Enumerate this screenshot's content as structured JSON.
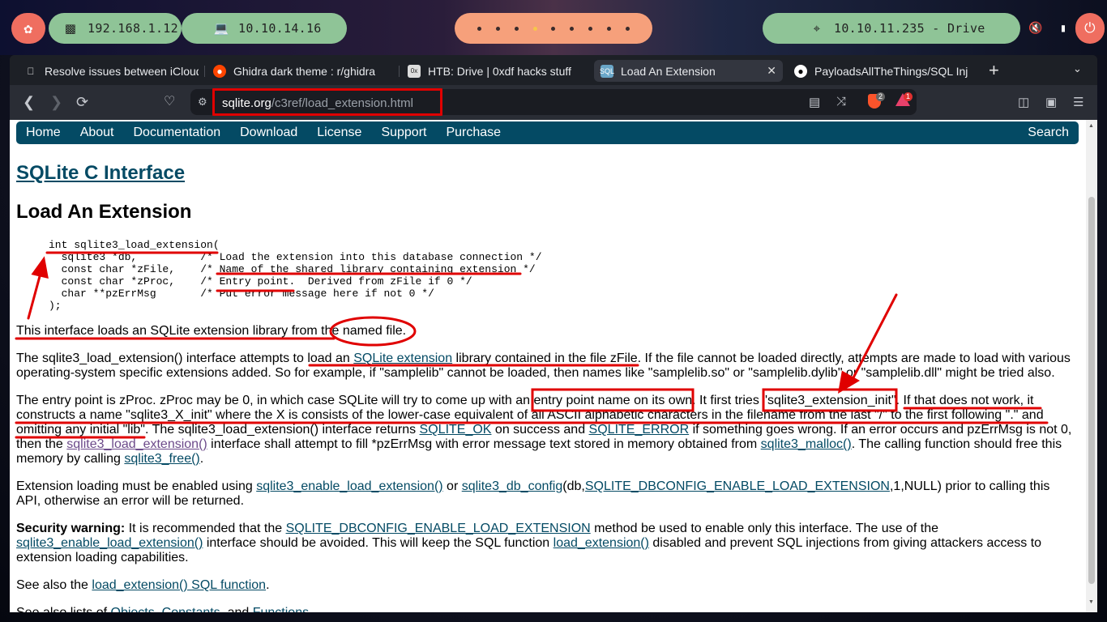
{
  "taskbar": {
    "ip_host": "192.168.1.12",
    "ip_vpn": "10.10.14.16",
    "target": "10.10.11.235 - Drive"
  },
  "tabs": [
    {
      "title": "Resolve issues between iCloud",
      "favicon": "apple-icon",
      "active": false
    },
    {
      "title": "Ghidra dark theme : r/ghidra",
      "favicon": "reddit-icon",
      "active": false
    },
    {
      "title": "HTB: Drive | 0xdf hacks stuff",
      "favicon": "0xdf-icon",
      "active": false
    },
    {
      "title": "Load An Extension",
      "favicon": "sqlite-icon",
      "active": true
    },
    {
      "title": "PayloadsAllTheThings/SQL Inj",
      "favicon": "github-icon",
      "active": false
    }
  ],
  "toolbar": {
    "url_domain": "sqlite.org",
    "url_path": "/c3ref/load_extension.html",
    "brave_badge": "2",
    "rewards_badge": "1"
  },
  "page": {
    "menu": [
      "Home",
      "About",
      "Documentation",
      "Download",
      "License",
      "Support",
      "Purchase"
    ],
    "search": "Search",
    "section_title": "SQLite C Interface",
    "title": "Load An Extension",
    "code_lines": [
      "int sqlite3_load_extension(",
      "  sqlite3 *db,          /* Load the extension into this database connection */",
      "  const char *zFile,    /* Name of the shared library containing extension */",
      "  const char *zProc,    /* Entry point.  Derived from zFile if 0 */",
      "  char **pzErrMsg       /* Put error message here if not 0 */",
      ");"
    ],
    "p1": "This interface loads an SQLite extension library from the named file.",
    "p2": {
      "a": "The sqlite3_load_extension() interface attempts to load an ",
      "link": "SQLite extension",
      "b": " library contained in the file zFile. If the file cannot be loaded directly, attempts are made to load with various operating-system specific extensions added. So for example, if \"samplelib\" cannot be loaded, then names like \"samplelib.so\" or \"samplelib.dylib\" or \"samplelib.dll\" might be tried also."
    },
    "p3": {
      "a": "The entry point is zProc. zProc may be 0, in which case SQLite will try to come up with an entry point name on its own. It first tries \"sqlite3_extension_init\". If that does not work, it constructs a name \"sqlite3_X_init\" where the X is consists of the lower-case equivalent of all ASCII alphabetic characters in the filename from the last \"/\" to the first following \".\" and omitting any initial \"lib\". The sqlite3_load_extension() interface returns ",
      "link1": "SQLITE_OK",
      "b": " on success and ",
      "link2": "SQLITE_ERROR",
      "c": " if something goes wrong. If an error occurs and pzErrMsg is not 0, then the ",
      "link3": "sqlite3_load_extension()",
      "d": " interface shall attempt to fill *pzErrMsg with error message text stored in memory obtained from ",
      "link4": "sqlite3_malloc()",
      "e": ". The calling function should free this memory by calling ",
      "link5": "sqlite3_free()",
      "f": "."
    },
    "p4": {
      "a": "Extension loading must be enabled using ",
      "link1": "sqlite3_enable_load_extension()",
      "b": " or ",
      "link2": "sqlite3_db_config",
      "c": "(db,",
      "link3": "SQLITE_DBCONFIG_ENABLE_LOAD_EXTENSION",
      "d": ",1,NULL) prior to calling this API, otherwise an error will be returned."
    },
    "p5": {
      "bold": "Security warning:",
      "a": " It is recommended that the ",
      "link1": "SQLITE_DBCONFIG_ENABLE_LOAD_EXTENSION",
      "b": " method be used to enable only this interface. The use of the ",
      "link2": "sqlite3_enable_load_extension()",
      "c": " interface should be avoided. This will keep the SQL function ",
      "link3": "load_extension()",
      "d": " disabled and prevent SQL injections from giving attackers access to extension loading capabilities."
    },
    "p6": {
      "a": "See also the ",
      "link": "load_extension() SQL function",
      "b": "."
    },
    "p7": {
      "a": "See also lists of ",
      "link1": "Objects",
      "b": ", ",
      "link2": "Constants",
      "c": ", and ",
      "link3": "Functions",
      "d": "."
    }
  },
  "colors": {
    "annotation": "#e00000",
    "sqlite_nav": "#044a64",
    "pill_green": "#8fc497",
    "pill_red": "#ef6e60",
    "pill_orange": "#f6a07b"
  }
}
